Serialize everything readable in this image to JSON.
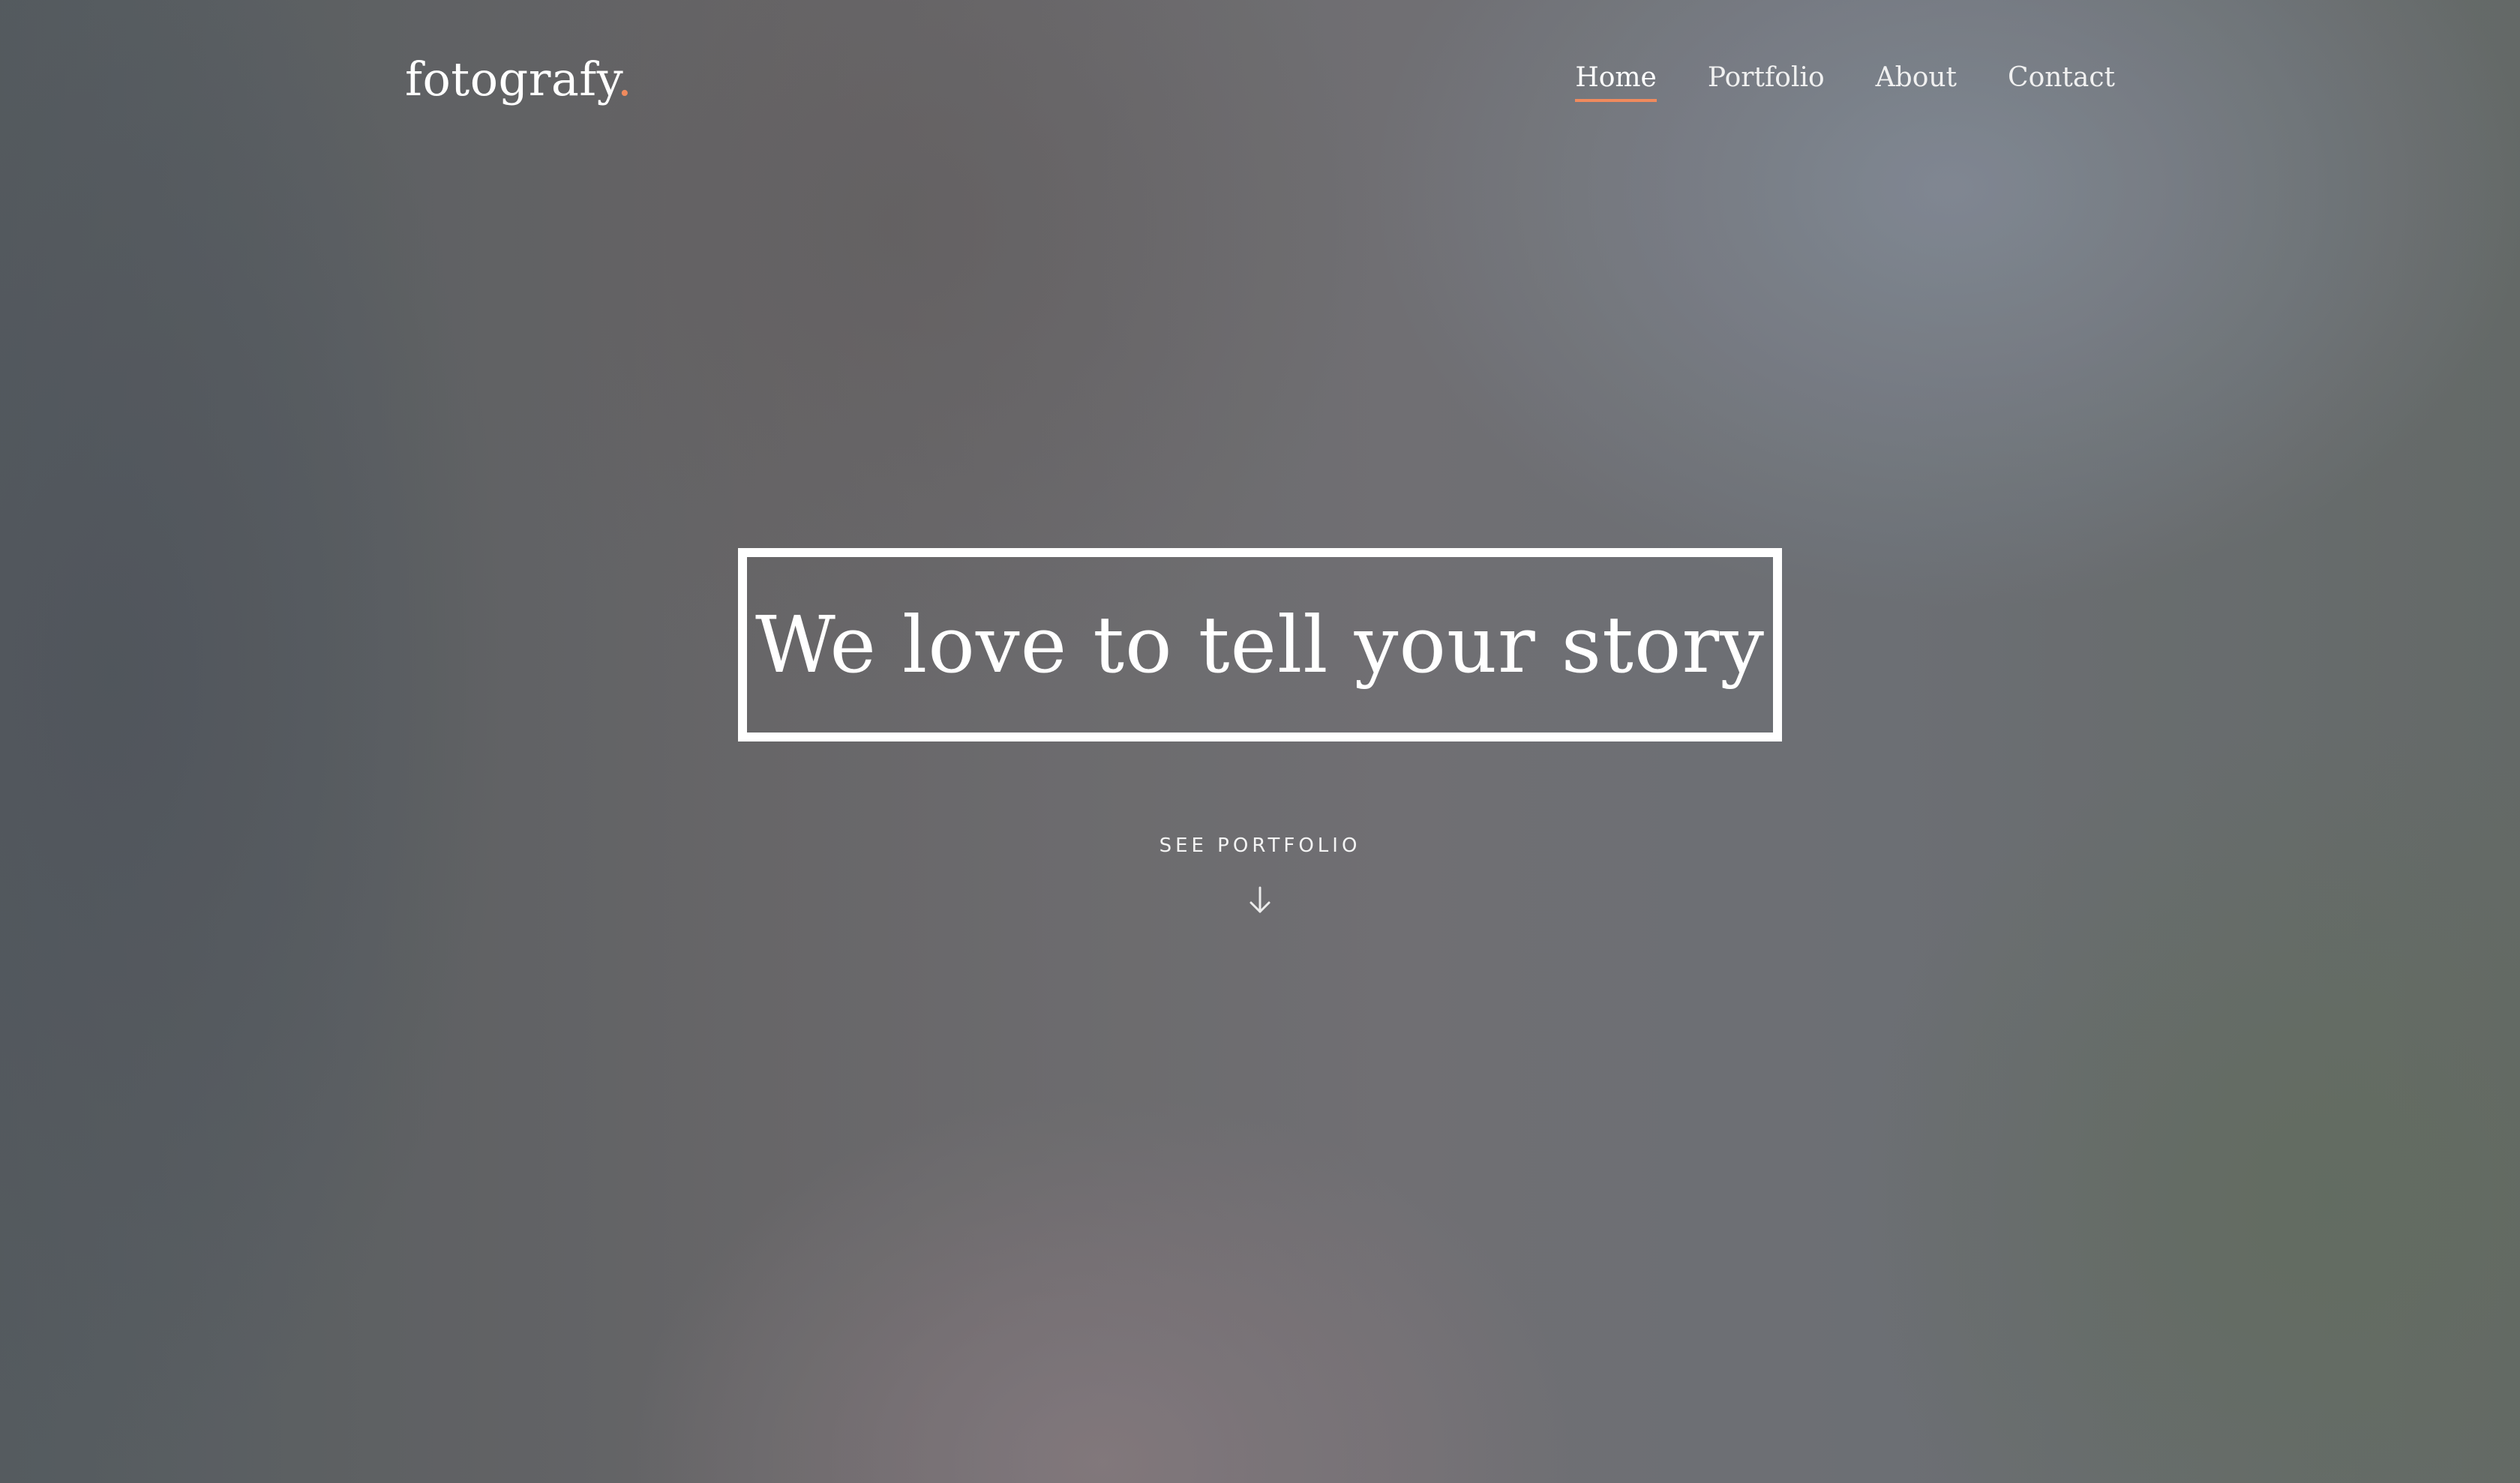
{
  "header": {
    "logo": {
      "text": "fotografy",
      "accent": "."
    },
    "nav": {
      "items": [
        {
          "label": "Home",
          "active": true
        },
        {
          "label": "Portfolio",
          "active": false
        },
        {
          "label": "About",
          "active": false
        },
        {
          "label": "Contact",
          "active": false
        }
      ]
    }
  },
  "hero": {
    "headline": "We love to tell your story",
    "cta_label": "SEE PORTFOLIO",
    "cta_icon": "arrow-down-icon"
  },
  "theme": {
    "accent_color": "#f08a5d",
    "text_color": "#ffffff"
  }
}
